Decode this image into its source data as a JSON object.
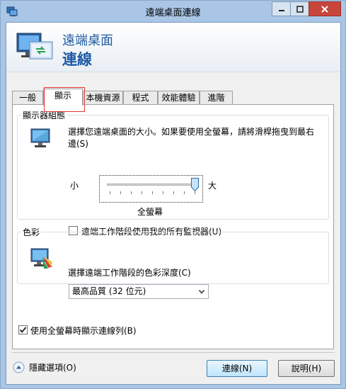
{
  "window": {
    "title": "遠端桌面連線",
    "header": {
      "line1": "遠端桌面",
      "line2": "連線"
    }
  },
  "tabs": [
    {
      "label": "一般",
      "active": false
    },
    {
      "label": "顯示",
      "active": true
    },
    {
      "label": "本機資源",
      "active": false
    },
    {
      "label": "程式",
      "active": false
    },
    {
      "label": "效能體驗",
      "active": false
    },
    {
      "label": "進階",
      "active": false
    }
  ],
  "display": {
    "group_title": "顯示器組態",
    "description": "選擇您遠端桌面的大小。如果要使用全螢幕，請將滑桿拖曳到最右邊(S)",
    "slider_small": "小",
    "slider_large": "大",
    "slider_value_label": "全螢幕",
    "slider_fraction": 1.0,
    "use_all_monitors": {
      "label": "遠端工作階段使用我的所有監視器(U)",
      "checked": false
    }
  },
  "colors": {
    "group_title": "色彩",
    "description": "選擇遠端工作階段的色彩深度(C)",
    "selected": "最高品質 (32 位元)"
  },
  "connection_bar": {
    "label": "使用全螢幕時顯示連線列(B)",
    "checked": true
  },
  "footer": {
    "hide_options": "隱藏選項(O)",
    "connect": "連線(N)",
    "help": "說明(H)"
  },
  "icons": {
    "app": "remote-desktop-icon",
    "header": "remote-desktop-logo-icon",
    "monitor": "monitor-icon",
    "colors": "color-palette-icon"
  }
}
